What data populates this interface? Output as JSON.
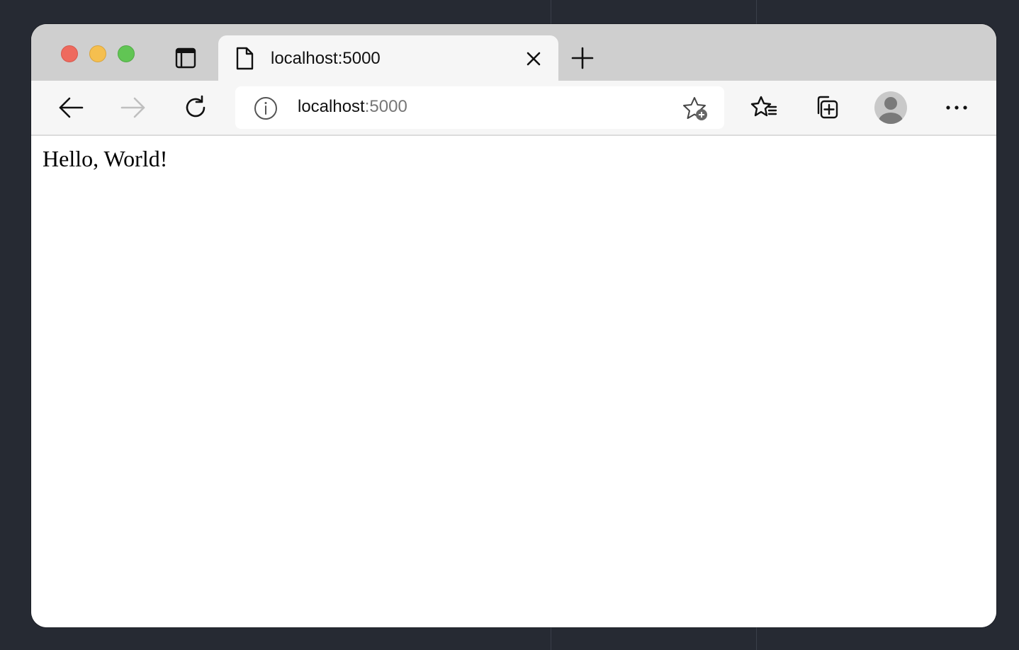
{
  "tab": {
    "title": "localhost:5000",
    "icon": "document-icon"
  },
  "address_bar": {
    "host": "localhost",
    "port": ":5000"
  },
  "page": {
    "text": "Hello, World!"
  },
  "colors": {
    "close": "#ee6a5e",
    "minimize": "#f5bf4f",
    "maximize": "#61c554",
    "disabled_icon": "#bfbfbf"
  }
}
